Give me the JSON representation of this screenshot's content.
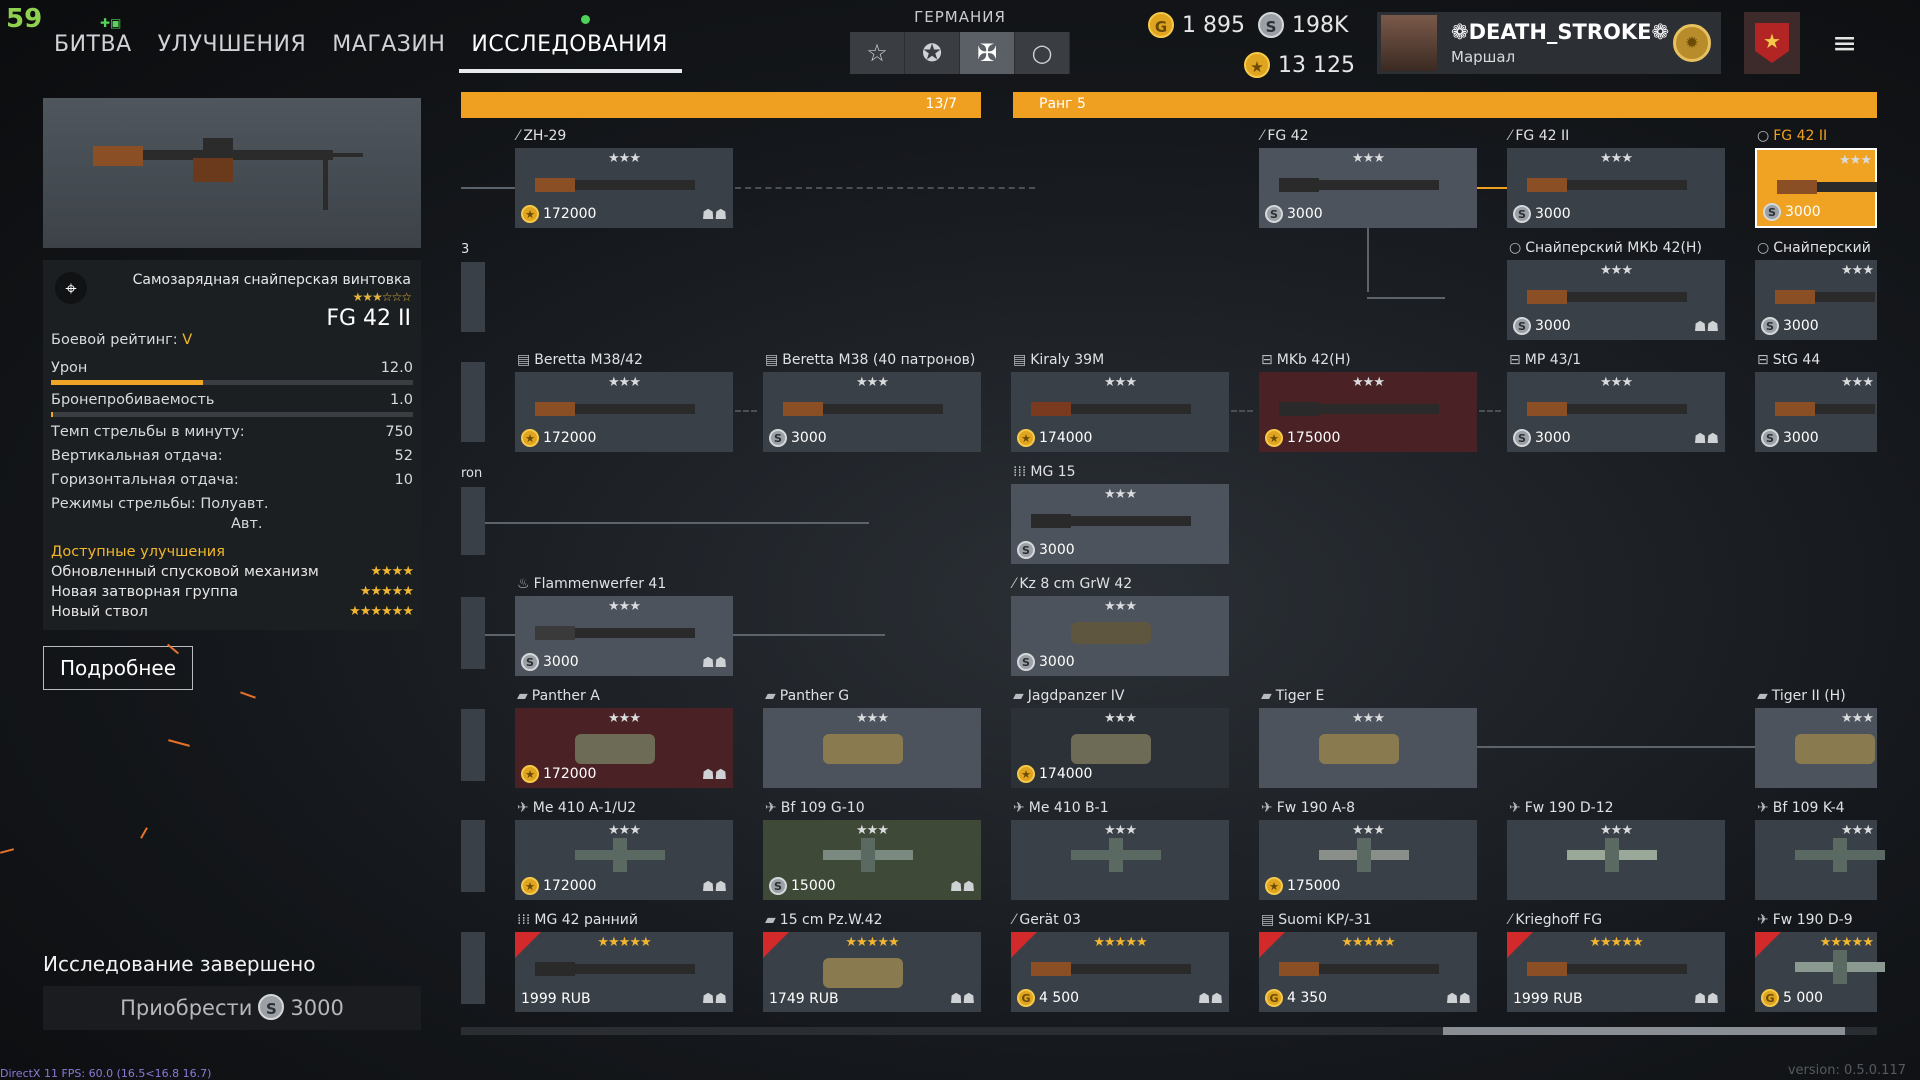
{
  "fps_counter": "59",
  "nav": {
    "battle": "БИТВА",
    "upgrades": "УЛУЧШЕНИЯ",
    "shop": "МАГАЗИН",
    "research": "ИССЛЕДОВАНИЯ",
    "active": "research"
  },
  "nation": {
    "label": "ГЕРМАНИЯ",
    "buttons": [
      "star-icon",
      "circle-star-icon",
      "iron-cross-icon",
      "circle-icon"
    ],
    "selected_index": 2
  },
  "currency": {
    "gold": "1 895",
    "silver": "198K",
    "xp": "13 125"
  },
  "profile": {
    "name": "DEATH_STROKE",
    "rank": "Маршал"
  },
  "left_panel": {
    "weapon_type": "Самозарядная снайперская винтовка",
    "weapon_name": "FG 42 II",
    "rating_label": "Боевой рейтинг:",
    "rating_value": "V",
    "stats": [
      {
        "label": "Урон",
        "value": "12.0",
        "bar": 0.42
      },
      {
        "label": "Бронепробиваемость",
        "value": "1.0",
        "bar": 0.0
      }
    ],
    "params": [
      {
        "label": "Темп стрельбы в минуту:",
        "value": "750"
      },
      {
        "label": "Вертикальная отдача:",
        "value": "52"
      },
      {
        "label": "Горизонтальная отдача:",
        "value": "10"
      }
    ],
    "fire_modes_label": "Режимы стрельбы: Полуавт.",
    "fire_modes_line2": "Авт.",
    "upgrades_title": "Доступные улучшения",
    "upgrades": [
      {
        "name": "Обновленный спусковой механизм",
        "stars": 4
      },
      {
        "name": "Новая затворная группа",
        "stars": 5
      },
      {
        "name": "Новый ствол",
        "stars": 6
      }
    ],
    "more_button": "Подробнее",
    "research_done": "Исследование завершено",
    "buy_label": "Приобрести",
    "buy_price": "3000"
  },
  "rank_bar": {
    "progress": "13/7",
    "rank": "Ранг 5"
  },
  "side_labels": {
    "row2": "3",
    "row4": "ron"
  },
  "tree": {
    "row1": [
      {
        "name": "ZH-29",
        "price": "172000",
        "cur": "xp",
        "style": "normal"
      },
      {
        "name": "FG 42",
        "price": "3000",
        "cur": "silver",
        "style": "normal"
      },
      {
        "name": "FG 42 II",
        "price": "3000",
        "cur": "silver",
        "style": "normal"
      },
      {
        "name": "FG 42 II",
        "price": "3000",
        "cur": "silver",
        "style": "selected"
      }
    ],
    "row2": [
      {
        "name": "Снайперский МКb 42(H)",
        "price": "3000",
        "cur": "silver"
      },
      {
        "name": "Снайперский",
        "price": "3000",
        "cur": "silver"
      }
    ],
    "row3": [
      {
        "name": "Beretta M38/42",
        "price": "172000",
        "cur": "xp"
      },
      {
        "name": "Beretta M38 (40 патронов)",
        "price": "3000",
        "cur": "silver"
      },
      {
        "name": "Kiraly 39M",
        "price": "174000",
        "cur": "xp"
      },
      {
        "name": "MKb 42(H)",
        "price": "175000",
        "cur": "xp",
        "style": "red"
      },
      {
        "name": "MP 43/1",
        "price": "3000",
        "cur": "silver"
      },
      {
        "name": "StG 44",
        "price": "3000",
        "cur": "silver"
      }
    ],
    "row4": [
      {
        "name": "MG 15",
        "price": "3000",
        "cur": "silver"
      }
    ],
    "row5": [
      {
        "name": "Flammenwerfer 41",
        "price": "3000",
        "cur": "silver"
      },
      {
        "name": "Kz 8 cm GrW 42",
        "price": "3000",
        "cur": "silver"
      }
    ],
    "row6": [
      {
        "name": "Panther A",
        "price": "172000",
        "cur": "xp",
        "style": "red"
      },
      {
        "name": "Panther G",
        "price": "",
        "cur": ""
      },
      {
        "name": "Jagdpanzer IV",
        "price": "174000",
        "cur": "xp"
      },
      {
        "name": "Tiger E",
        "price": "",
        "cur": ""
      },
      {
        "name": "Tiger II (H)",
        "price": "",
        "cur": ""
      }
    ],
    "row7": [
      {
        "name": "Me 410 A-1/U2",
        "price": "172000",
        "cur": "xp"
      },
      {
        "name": "Bf 109 G-10",
        "price": "15000",
        "cur": "silver",
        "style": "green"
      },
      {
        "name": "Me 410 B-1",
        "price": "",
        "cur": ""
      },
      {
        "name": "Fw 190 A-8",
        "price": "175000",
        "cur": "xp"
      },
      {
        "name": "Fw 190 D-12",
        "price": "",
        "cur": ""
      },
      {
        "name": "Bf 109 K-4",
        "price": "",
        "cur": ""
      }
    ],
    "row8": [
      {
        "name": "MG 42 ранний",
        "price": "1999 RUB",
        "cur": ""
      },
      {
        "name": "15 cm Pz.W.42",
        "price": "1749 RUB",
        "cur": ""
      },
      {
        "name": "Gerät 03",
        "price": "4 500",
        "cur": "gold"
      },
      {
        "name": "Suomi KP/-31",
        "price": "4 350",
        "cur": "gold"
      },
      {
        "name": "Krieghoff FG",
        "price": "1999 RUB",
        "cur": ""
      },
      {
        "name": "Fw 190 D-9",
        "price": "5 000",
        "cur": "gold"
      }
    ]
  },
  "footer": {
    "directx": "DirectX 11 FPS: 60.0 (16.5<16.8 16.7)",
    "version": "version: 0.5.0.117"
  },
  "colors": {
    "accent": "#f0a020",
    "selected_card": "#f0a322",
    "red_card": "#4a2226"
  }
}
